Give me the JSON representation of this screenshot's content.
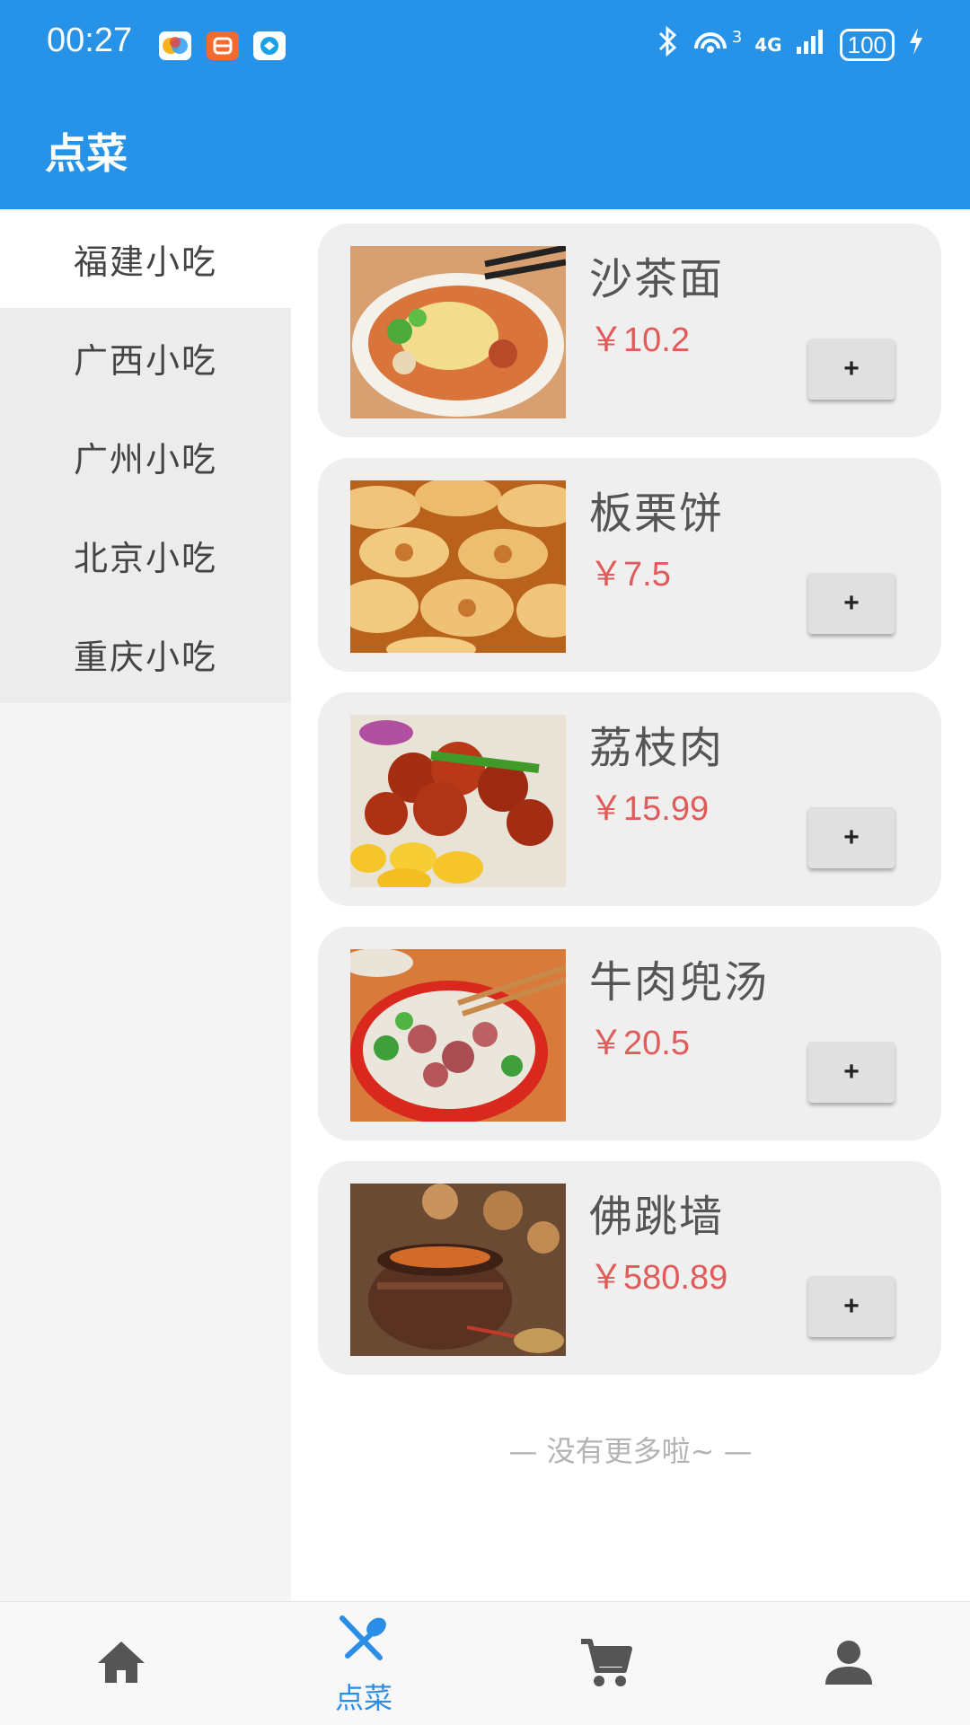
{
  "status_bar": {
    "time": "00:27",
    "network": "4G",
    "sim_badge": "3",
    "battery": "100"
  },
  "app_bar": {
    "title": "点菜"
  },
  "categories": [
    {
      "label": "福建小吃",
      "active": true
    },
    {
      "label": "广西小吃",
      "active": false
    },
    {
      "label": "广州小吃",
      "active": false
    },
    {
      "label": "北京小吃",
      "active": false
    },
    {
      "label": "重庆小吃",
      "active": false
    }
  ],
  "dishes": [
    {
      "name": "沙茶面",
      "price": "￥10.2",
      "add_label": "+"
    },
    {
      "name": "板栗饼",
      "price": "￥7.5",
      "add_label": "+"
    },
    {
      "name": "荔枝肉",
      "price": "￥15.99",
      "add_label": "+"
    },
    {
      "name": "牛肉兜汤",
      "price": "￥20.5",
      "add_label": "+"
    },
    {
      "name": "佛跳墙",
      "price": "￥580.89",
      "add_label": "+"
    }
  ],
  "list_footer": "— 没有更多啦~ —",
  "bottom_nav": {
    "home_icon": "home-icon",
    "order_icon": "fork-spoon-icon",
    "order_label": "点菜",
    "cart_icon": "cart-icon",
    "profile_icon": "person-icon"
  },
  "colors": {
    "primary": "#2692e8",
    "price": "#e25b5b",
    "nav_active": "#2a8de6",
    "nav_inactive": "#555555"
  }
}
